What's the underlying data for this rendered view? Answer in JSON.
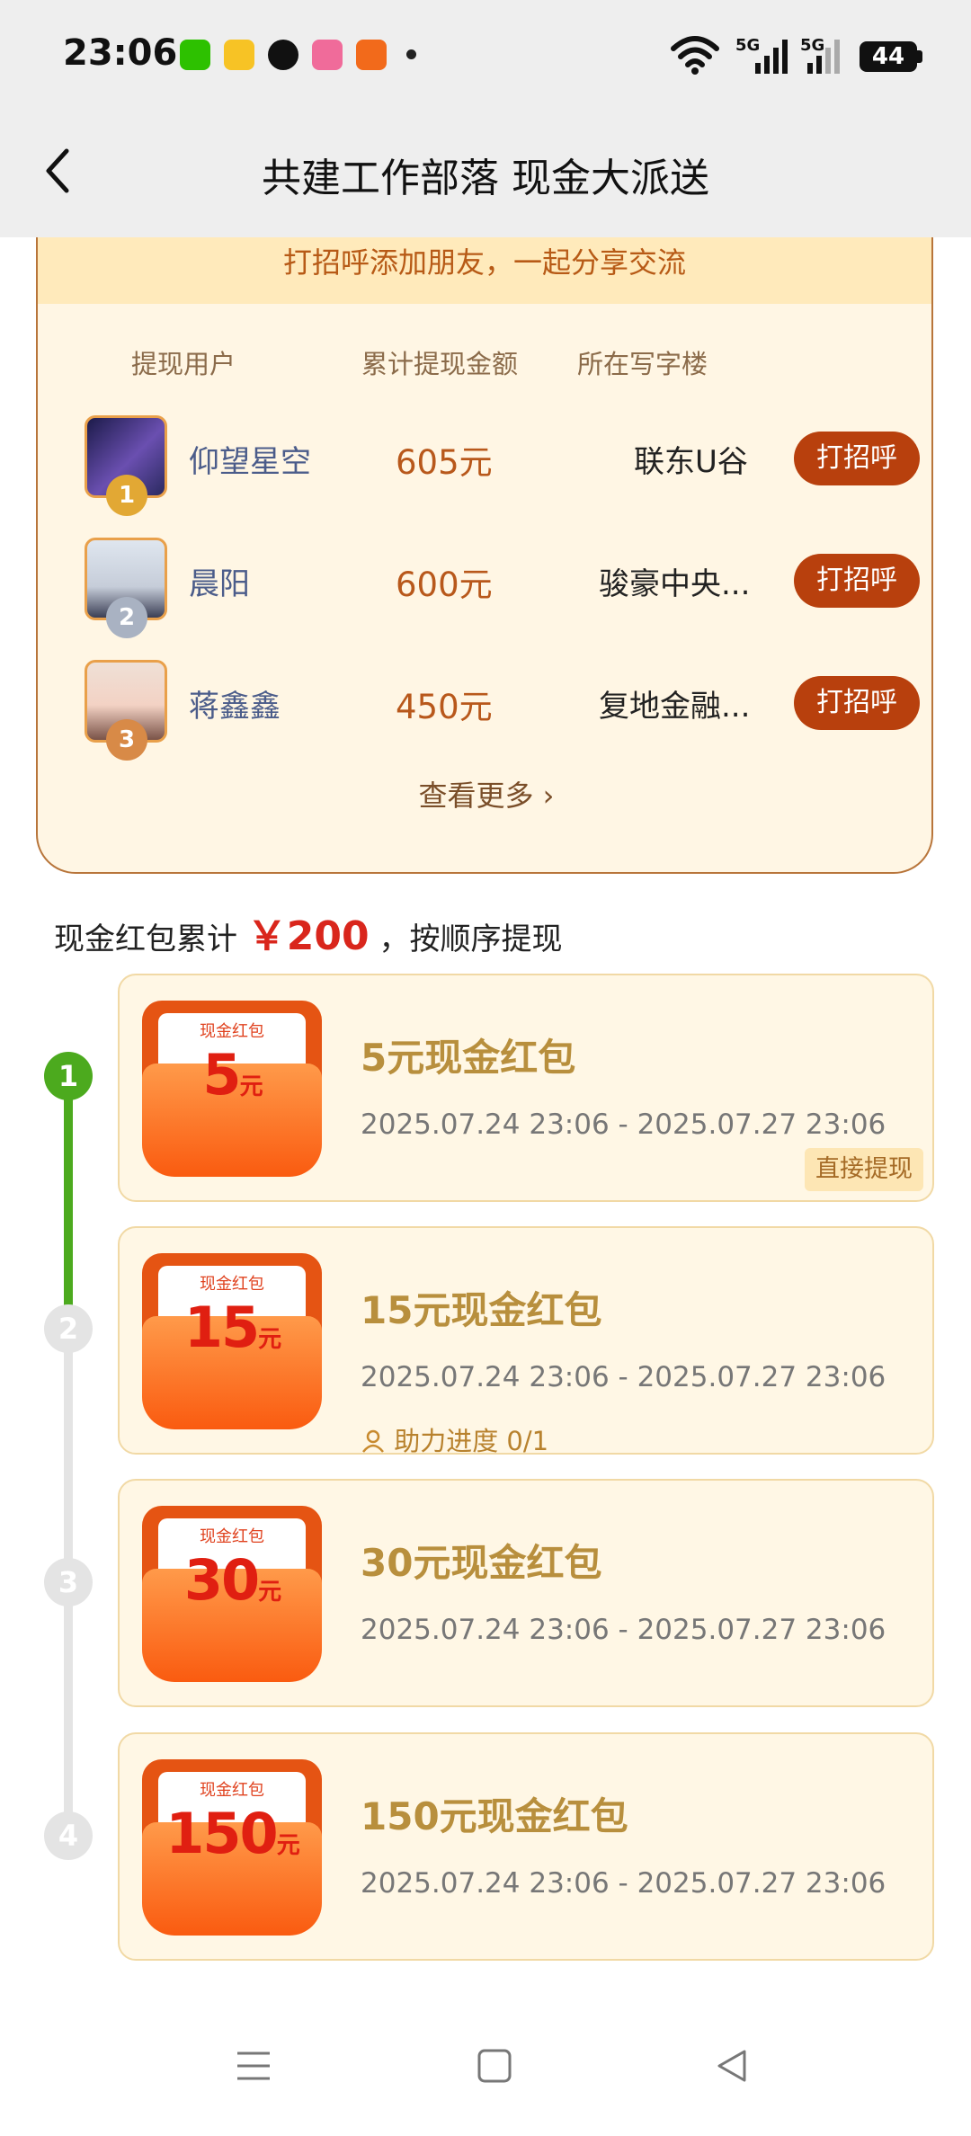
{
  "status": {
    "time": "23:06",
    "network1": "5G",
    "network2": "5G",
    "battery": "44"
  },
  "header": {
    "title": "共建工作部落 现金大派送"
  },
  "leaderboard": {
    "banner": "打招呼添加朋友，一起分享交流",
    "columns": [
      "提现用户",
      "累计提现金额",
      "所在写字楼"
    ],
    "rows": [
      {
        "rank": "1",
        "name": "仰望星空",
        "amount": "605元",
        "building": "联东U谷",
        "action": "打招呼",
        "medal_color": "#e2a834"
      },
      {
        "rank": "2",
        "name": "晨阳",
        "amount": "600元",
        "building": "骏豪中央...",
        "action": "打招呼",
        "medal_color": "#a9b2c2"
      },
      {
        "rank": "3",
        "name": "蒋鑫鑫",
        "amount": "450元",
        "building": "复地金融...",
        "action": "打招呼",
        "medal_color": "#d88a47"
      }
    ],
    "more": "查看更多 ›"
  },
  "summary": {
    "prefix": "现金红包累计",
    "amount": "￥200",
    "suffix": "，按顺序提现"
  },
  "packets": [
    {
      "step": "1",
      "label": "现金红包",
      "value": "5",
      "unit": "元",
      "title": "5元现金红包",
      "date": "2025.07.24 23:06 - 2025.07.27 23:06",
      "tag": "直接提现",
      "active": true
    },
    {
      "step": "2",
      "label": "现金红包",
      "value": "15",
      "unit": "元",
      "title": "15元现金红包",
      "date": "2025.07.24 23:06 - 2025.07.27 23:06",
      "progress": "助力进度 0/1",
      "active": false
    },
    {
      "step": "3",
      "label": "现金红包",
      "value": "30",
      "unit": "元",
      "title": "30元现金红包",
      "date": "2025.07.24 23:06 - 2025.07.27 23:06",
      "active": false
    },
    {
      "step": "4",
      "label": "现金红包",
      "value": "150",
      "unit": "元",
      "title": "150元现金红包",
      "date": "2025.07.24 23:06 - 2025.07.27 23:06",
      "active": false
    }
  ],
  "colors": {
    "accent": "#b8400d",
    "active_step": "#4caa1e",
    "inactive_step": "#e4e4e4",
    "amount_red": "#d9261c"
  }
}
